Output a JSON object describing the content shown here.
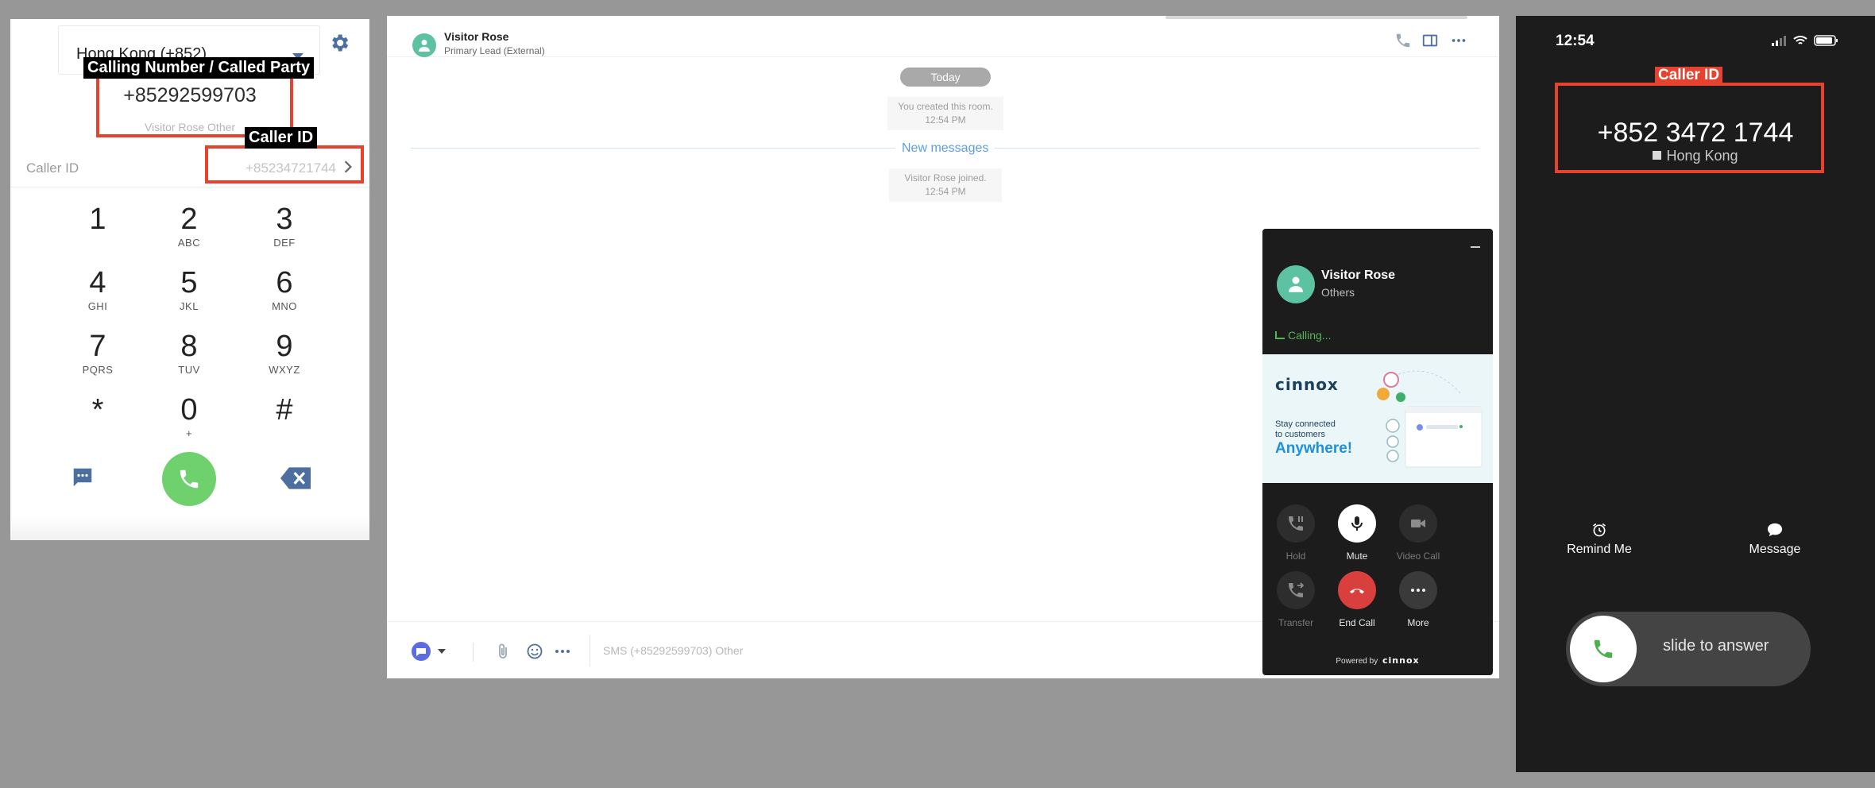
{
  "dialer": {
    "country": "Hong Kong (+852)",
    "called_number": "+85292599703",
    "party_name": "Visitor Rose Other",
    "caller_id_label": "Caller ID",
    "caller_id_value": "+85234721744",
    "keys": [
      {
        "digit": "1",
        "letters": ""
      },
      {
        "digit": "2",
        "letters": "ABC"
      },
      {
        "digit": "3",
        "letters": "DEF"
      },
      {
        "digit": "4",
        "letters": "GHI"
      },
      {
        "digit": "5",
        "letters": "JKL"
      },
      {
        "digit": "6",
        "letters": "MNO"
      },
      {
        "digit": "7",
        "letters": "PQRS"
      },
      {
        "digit": "8",
        "letters": "TUV"
      },
      {
        "digit": "9",
        "letters": "WXYZ"
      },
      {
        "digit": "*",
        "letters": ""
      },
      {
        "digit": "0",
        "letters": "+"
      },
      {
        "digit": "#",
        "letters": ""
      }
    ]
  },
  "annotations": {
    "calling_number": "Calling Number / Called Party",
    "caller_id": "Caller ID",
    "phone_caller_id": "Caller ID"
  },
  "chat": {
    "contact_name": "Visitor Rose",
    "contact_role": "Primary Lead (External)",
    "today": "Today",
    "created_msg": "You created this room.",
    "created_time": "12:54 PM",
    "new_messages": "New messages",
    "joined_msg": "Visitor Rose joined.",
    "joined_time": "12:54 PM",
    "composer_placeholder": "SMS (+85292599703) Other"
  },
  "call_widget": {
    "name": "Visitor Rose",
    "subtitle": "Others",
    "status": "Calling...",
    "banner_brand": "cinnox",
    "banner_line1": "Stay connected",
    "banner_line2": "to customers",
    "banner_highlight": "Anywhere!",
    "controls": {
      "hold": "Hold",
      "mute": "Mute",
      "video": "Video Call",
      "transfer": "Transfer",
      "end": "End Call",
      "more": "More"
    },
    "powered_by": "Powered by",
    "powered_brand": "cinnox"
  },
  "phone": {
    "time": "12:54",
    "number": "+852 3472 1744",
    "location": "Hong Kong",
    "remind": "Remind Me",
    "message": "Message",
    "slide": "slide to answer"
  },
  "colors": {
    "call_green": "#6fd06e",
    "annotation_red": "#e5432f",
    "end_call_red": "#d9403d",
    "accent_teal": "#5cc2a1",
    "link_blue": "#5a9fe0"
  }
}
